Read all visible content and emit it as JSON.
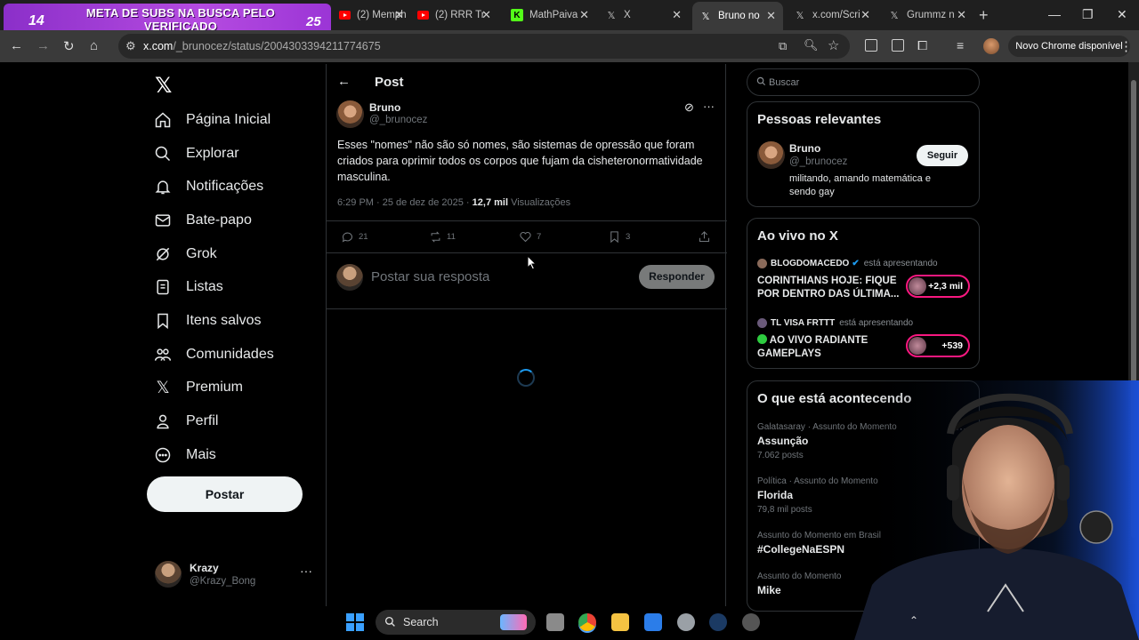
{
  "browser": {
    "promo": {
      "count_left": "14",
      "text": "META DE SUBS NA BUSCA PELO VERIFICADO",
      "count_right": "25"
    },
    "tabs": [
      {
        "title": "(2) Memph",
        "icon": "youtube-icon"
      },
      {
        "title": "(2) RRR Tra",
        "icon": "youtube-icon"
      },
      {
        "title": "MathPaiva",
        "icon": "kick-icon"
      },
      {
        "title": "X",
        "icon": "x-logo-icon"
      },
      {
        "title": "Bruno no",
        "icon": "x-logo-icon"
      },
      {
        "title": "x.com/Scri",
        "icon": "x-logo-icon"
      },
      {
        "title": "Grummz n",
        "icon": "x-logo-icon"
      }
    ],
    "url_host": "x.com",
    "url_path": "/_brunocez/status/2004303394211774675",
    "update_label": "Novo Chrome disponível"
  },
  "sidebar": {
    "items": [
      {
        "label": "Página Inicial",
        "icon": "home-icon"
      },
      {
        "label": "Explorar",
        "icon": "search-icon"
      },
      {
        "label": "Notificações",
        "icon": "bell-icon"
      },
      {
        "label": "Bate-papo",
        "icon": "mail-icon"
      },
      {
        "label": "Grok",
        "icon": "grok-icon"
      },
      {
        "label": "Listas",
        "icon": "list-icon"
      },
      {
        "label": "Itens salvos",
        "icon": "bookmark-icon"
      },
      {
        "label": "Comunidades",
        "icon": "communities-icon"
      },
      {
        "label": "Premium",
        "icon": "x-logo-icon"
      },
      {
        "label": "Perfil",
        "icon": "person-icon"
      },
      {
        "label": "Mais",
        "icon": "more-circle-icon"
      }
    ],
    "post_button": "Postar",
    "account": {
      "name": "Krazy",
      "handle": "@Krazy_Bong"
    }
  },
  "post": {
    "header": "Post",
    "author_name": "Bruno",
    "author_handle": "@_brunocez",
    "text": "Esses \"nomes\" não são só nomes, são sistemas de opressão que foram criados para oprimir todos os corpos que fujam da cisheteronormatividade masculina.",
    "time": "6:29 PM · 25 de dez de 2025 ·",
    "views_count": "12,7 mil",
    "views_label": "Visualizações",
    "stats": {
      "replies": "21",
      "reposts": "11",
      "likes": "7",
      "bookmarks": "3"
    },
    "reply_placeholder": "Postar sua resposta",
    "reply_button": "Responder"
  },
  "right": {
    "search_placeholder": "Buscar",
    "relevant": {
      "title": "Pessoas relevantes",
      "name": "Bruno",
      "handle": "@_brunocez",
      "bio": "militando, amando matemática e sendo gay",
      "follow": "Seguir"
    },
    "live": {
      "title": "Ao vivo no X",
      "items": [
        {
          "host": "BLOGDOMACEDO",
          "status": "está apresentando",
          "title": "CORINTHIANS HOJE: FIQUE POR DENTRO DAS ÚLTIMA...",
          "listeners": "+2,3 mil"
        },
        {
          "host": "TL VISA FRTTT",
          "status": "está apresentando",
          "title": "AO VIVO RADIANTE GAMEPLAYS",
          "listeners": "+539"
        }
      ]
    },
    "trends": {
      "title": "O que está acontecendo",
      "items": [
        {
          "category": "Galatasaray · Assunto do Momento",
          "name": "Assunção",
          "count": "7.062 posts"
        },
        {
          "category": "Política · Assunto do Momento",
          "name": "Florida",
          "count": "79,8 mil posts"
        },
        {
          "category": "Assunto do Momento em Brasil",
          "name": "#CollegeNaESPN",
          "count": ""
        },
        {
          "category": "Assunto do Momento",
          "name": "Mike",
          "count": ""
        }
      ]
    }
  },
  "taskbar": {
    "search_label": "Search"
  },
  "colors": {
    "x_blue": "#1d9bf0",
    "live_pink": "#f91880",
    "promo_purple": "#a23fd6"
  }
}
